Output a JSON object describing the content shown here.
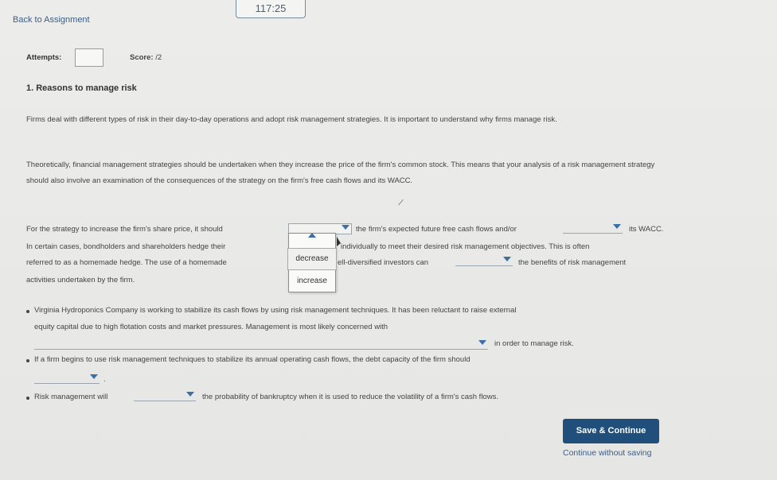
{
  "timer": "117:25",
  "nav": {
    "back_label": "Back to Assignment"
  },
  "meta": {
    "attempts_label": "Attempts:",
    "score_label": "Score:",
    "score_value": "/2"
  },
  "question": {
    "title": "1. Reasons to manage risk",
    "p1": "Firms deal with different types of risk in their day-to-day operations and adopt risk management strategies. It is important to understand why firms manage risk.",
    "p2": "Theoretically, financial management strategies should be undertaken when they increase the price of the firm's common stock. This means that your analysis of a risk management strategy should also involve an examination of the consequences of the strategy on the firm's free cash flows and its WACC.",
    "line1a": "For the strategy to increase the firm's share price, it should",
    "line1b": "the firm's expected future free cash flows and/or",
    "line1c": "its WACC.",
    "line2a": "In certain cases, bondholders and shareholders hedge their",
    "line2b": "individually to meet their desired risk management objectives. This is often",
    "line3a": "referred to as a homemade hedge. The use of a homemade",
    "line3b": "ell-diversified investors can",
    "line3c": "the benefits of risk management",
    "line4a": "activities undertaken by the firm."
  },
  "dropdown_menu": {
    "options": [
      "decrease",
      "increase"
    ]
  },
  "bullets": {
    "b1_line1": "Virginia Hydroponics Company is working to stabilize its cash flows by using risk management techniques. It has been reluctant to raise external",
    "b1_line2": "equity capital due to high flotation costs and market pressures. Management is most likely concerned with",
    "b1_line3": "in order to manage risk.",
    "b2_line1": "If a firm begins to use risk management techniques to stabilize its annual operating cash flows, the debt capacity of the firm should",
    "b2_end": ".",
    "b3_a": "Risk management will",
    "b3_b": "the probability of bankruptcy when it is used to reduce the volatility of a firm's cash flows."
  },
  "actions": {
    "save_label": "Save & Continue",
    "continue_label": "Continue without saving"
  },
  "colors": {
    "accent": "#1f4f7a",
    "link": "#3b5f86",
    "dropdown_arrow": "#3b6fa5"
  },
  "icons": {
    "dropdown": "chevron-down-icon"
  }
}
